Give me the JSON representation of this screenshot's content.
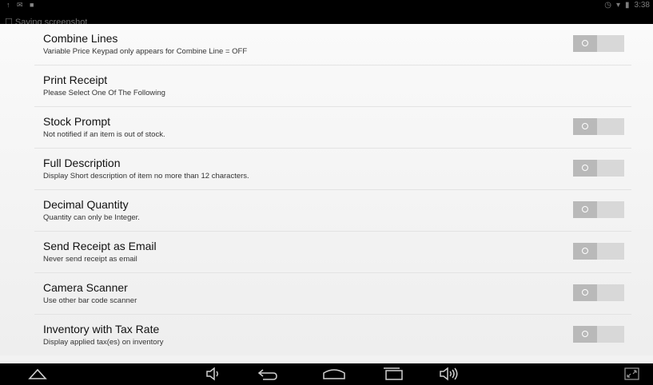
{
  "status_bar": {
    "left_icons": "↑ ✉ ■",
    "notification": "Saving screenshot",
    "time": "3:38"
  },
  "settings": [
    {
      "title": "Combine Lines",
      "subtitle": "Variable Price Keypad only appears for Combine Line = OFF",
      "has_toggle": true,
      "enabled": false
    },
    {
      "title": "Print Receipt",
      "subtitle": "Please Select One Of The Following",
      "has_toggle": false
    },
    {
      "title": "Stock Prompt",
      "subtitle": "Not notified if an item is out of stock.",
      "has_toggle": true,
      "enabled": false
    },
    {
      "title": "Full Description",
      "subtitle": "Display Short description of item no more than 12 characters.",
      "has_toggle": true,
      "enabled": false
    },
    {
      "title": "Decimal Quantity",
      "subtitle": "Quantity can only be Integer.",
      "has_toggle": true,
      "enabled": false
    },
    {
      "title": "Send Receipt as Email",
      "subtitle": "Never send receipt as email",
      "has_toggle": true,
      "enabled": false
    },
    {
      "title": "Camera Scanner",
      "subtitle": "Use other bar code scanner",
      "has_toggle": true,
      "enabled": false
    },
    {
      "title": "Inventory with Tax Rate",
      "subtitle": "Display applied tax(es) on inventory",
      "has_toggle": true,
      "enabled": false
    }
  ],
  "nav_bar": {
    "icons": [
      "collapse-icon",
      "volume-down-icon",
      "back-icon",
      "home-icon",
      "recent-apps-icon",
      "volume-up-icon",
      "fullscreen-icon"
    ]
  },
  "colors": {
    "toggle_track": "#d8d8d8",
    "toggle_thumb": "#b9b9b9",
    "bars": "#000000"
  }
}
